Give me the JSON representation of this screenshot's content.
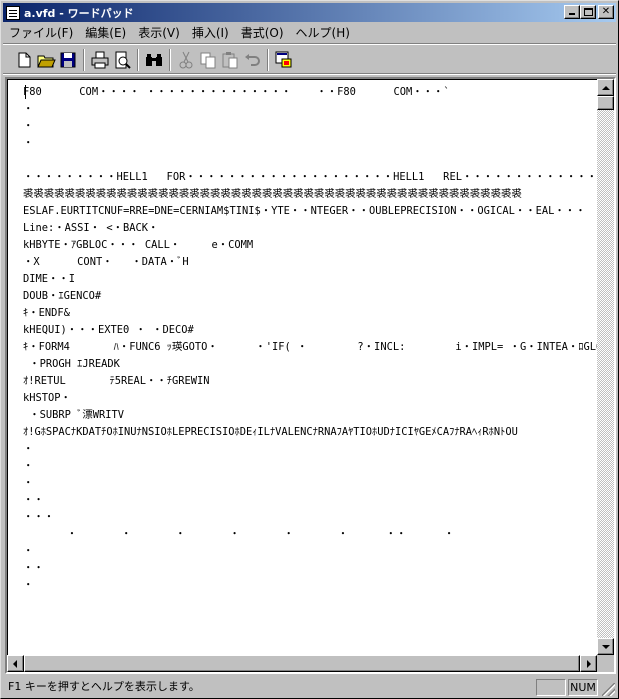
{
  "window": {
    "title": "a.vfd - ワードパッド"
  },
  "menu": [
    {
      "label": "ファイル(F)"
    },
    {
      "label": "編集(E)"
    },
    {
      "label": "表示(V)"
    },
    {
      "label": "挿入(I)"
    },
    {
      "label": "書式(O)"
    },
    {
      "label": "ヘルプ(H)"
    }
  ],
  "toolbar": {
    "icons": [
      "new-icon",
      "open-icon",
      "save-icon",
      "print-icon",
      "print-preview-icon",
      "find-icon",
      "cut-icon",
      "copy-icon",
      "paste-icon",
      "undo-icon",
      "insert-object-icon"
    ]
  },
  "document": {
    "lines": [
      "F80      COM・・・・ ・・・・・・・・・・・・・・    ・・F80      COM・・・`",
      "・",
      "・",
      "・",
      "",
      "・・・・・・・・・HELL1   FOR・・・・・・・・・・・・・・・・・・・・HELL1   REL・・・・・・・・・・・・・・・・・・・HELLO   F",
      "裘裘裘裘裘裘裘裘裘裘裘裘裘裘裘裘裘裘裘裘裘裘裘裘裘裘裘裘裘裘裘裘裘裘裘裘裘裘裘裘裘裘裘裘裘裘裘裘",
      "ESLAF.EURTITCNUF=RRE=DNE=CERNIAM$TINI$・YTE・・NTEGER・・OUBLEPRECISION・・OGICAL・・EAL・・・",
      "Line:・ASSI・ <・BACK・",
      "kHBYTE・ｱGBLOC・・・ CALL・     e・COMM",
      "・X      CONT・   ・DATA・ﾞH",
      "DIME・・I",
      "DOUB・ｴGENCO#",
      "ｷ・ENDF&",
      "kHEQUI)・・・EXTE0 ・ ・DECO#",
      "ｷ・FORM4       ﾊ・FUNC6 ｯ瑛GOTO・      ・'IF( ・        ?・INCL:        i・IMPL= ・G・INTEA・ﾛGLOC",
      " ・PROGH ｴJREADK",
      "ｵ!RETUL       ﾃ5REAL・・ﾁGREWIN",
      "kHSTOP・",
      " ・SUBRP ﾞ漂WRITV",
      "ｵ!GﾎSPACﾅKDATﾁOﾎINUﾅNSIOﾎLEPRECISIOﾎDEｨILﾅVALENCﾅRNAﾌAﾔTIOﾎUDﾅICIﾔGEﾒCAﾌﾅRAﾍｨRﾎNﾄOU",
      "・",
      "・",
      "・",
      "・・",
      "・・・",
      "       ・       ・       ・       ・       ・       ・      ・・      ・",
      "・",
      "・・",
      "・",
      "",
      "",
      "",
      "",
      "",
      "・・・・・・・                                      ・"
    ]
  },
  "status": {
    "help_text": "F1 キーを押すとヘルプを表示します。",
    "num": "NUM"
  }
}
